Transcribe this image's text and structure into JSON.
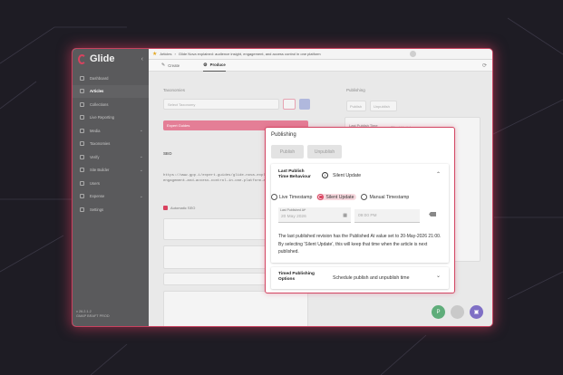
{
  "app": {
    "name": "Glide"
  },
  "sidebar": {
    "items": [
      {
        "label": "Dashboard",
        "active": false
      },
      {
        "label": "Articles",
        "active": true
      },
      {
        "label": "Collections",
        "active": false
      },
      {
        "label": "Live Reporting",
        "active": false
      },
      {
        "label": "Media",
        "active": false
      },
      {
        "label": "Taxonomies",
        "active": false
      },
      {
        "label": "Verify",
        "active": false
      },
      {
        "label": "Site Builder",
        "active": false
      },
      {
        "label": "Users",
        "active": false
      },
      {
        "label": "Expense",
        "active": false
      },
      {
        "label": "Settings",
        "active": false
      }
    ],
    "footer_version": "v 26.2.1.2",
    "footer_user": "GMAP BRAFT PROD"
  },
  "topbar": {
    "breadcrumb_root": "Articles",
    "breadcrumb_title": "Glide Nova explained: audience insight, engagement, and access control in one platform"
  },
  "tabs": [
    {
      "label": "Create",
      "glyph": "✎"
    },
    {
      "label": "Produce",
      "glyph": "⚙"
    }
  ],
  "background_panel": {
    "taxonomies_label": "Taxonomies",
    "taxonomy_placeholder": "Select Taxonomy",
    "expert_guides": "Expert Guides",
    "seo_label": "SEO",
    "seo_url": "https://www.gpp.i/expert-guides/glide-nova-explained-audience-insight-engagement-and-access-control-in-one-platform-a0gpgD0V4GM/",
    "auto_seo": "Automatic SEO",
    "publishing_label": "Publishing",
    "publish_btn": "Publish",
    "unpublish_btn": "Unpublish",
    "last_publish_label": "Last Publish Time Behaviour",
    "last_publish_value": "Silent Update"
  },
  "publishing": {
    "title": "Publishing",
    "publish_label": "Publish",
    "unpublish_label": "Unpublish",
    "last_publish": {
      "label_line1": "Last Publish",
      "label_line2": "Time Behaviour",
      "value": "Silent Update",
      "options": [
        "Live Timestamp",
        "Silent Update",
        "Manual Timestamp"
      ],
      "selected": "Silent Update",
      "date_label": "Last Published At*",
      "date_value": "20 May 2026",
      "time_value": "09:00 PM",
      "note": "The last published revision has the Published At value set to 20-May-2026 21:00. By selecting 'Silent Update', this will keep that time when the article is next published."
    },
    "timed": {
      "label_line1": "Timed Publishing",
      "label_line2": "Options",
      "value": "Schedule publish and unpublish time"
    }
  },
  "fab": {
    "publish": "P"
  },
  "colors": {
    "accent": "#d9425f",
    "sidebar": "#5a5a5c",
    "fab_green": "#5fad7a",
    "fab_purple": "#7f6fc5"
  }
}
